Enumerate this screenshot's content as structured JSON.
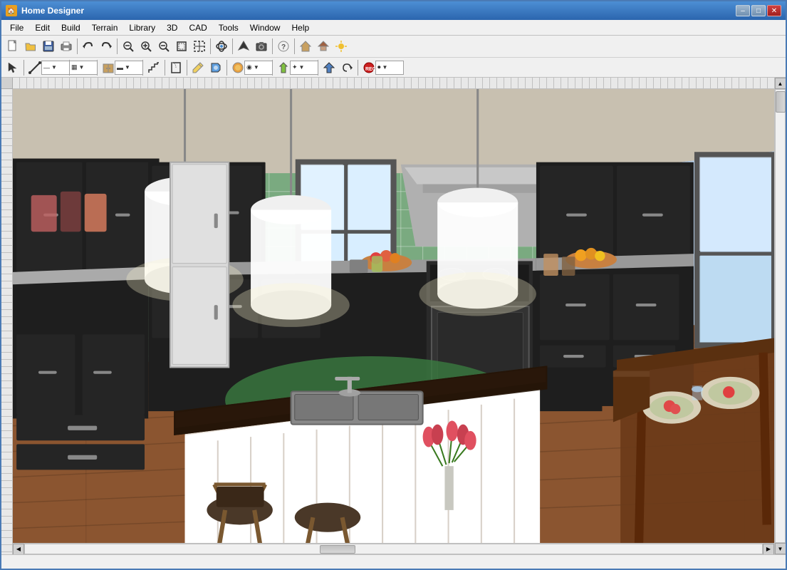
{
  "window": {
    "title": "Home Designer",
    "icon": "🏠"
  },
  "title_buttons": {
    "minimize": "–",
    "maximize": "□",
    "close": "✕"
  },
  "menu": {
    "items": [
      "File",
      "Edit",
      "Build",
      "Terrain",
      "Library",
      "3D",
      "CAD",
      "Tools",
      "Window",
      "Help"
    ]
  },
  "toolbar1": {
    "buttons": [
      {
        "name": "new",
        "icon": "📄"
      },
      {
        "name": "open",
        "icon": "📂"
      },
      {
        "name": "save",
        "icon": "💾"
      },
      {
        "name": "print",
        "icon": "🖨"
      },
      {
        "name": "undo",
        "icon": "↩"
      },
      {
        "name": "redo",
        "icon": "↪"
      },
      {
        "name": "zoom-in-prev",
        "icon": "🔍"
      },
      {
        "name": "zoom-in",
        "icon": "⊕"
      },
      {
        "name": "zoom-out",
        "icon": "⊖"
      },
      {
        "name": "fit-window",
        "icon": "⊞"
      },
      {
        "name": "zoom-box",
        "icon": "▣"
      },
      {
        "name": "refresh",
        "icon": "↺"
      },
      {
        "name": "orbit",
        "icon": "⟳"
      },
      {
        "name": "pan",
        "icon": "✋"
      },
      {
        "name": "mark1",
        "icon": "⟢"
      },
      {
        "name": "arrow-up",
        "icon": "↑"
      },
      {
        "name": "camera",
        "icon": "📷"
      },
      {
        "name": "question",
        "icon": "?"
      },
      {
        "name": "house",
        "icon": "🏠"
      },
      {
        "name": "roof",
        "icon": "⌂"
      },
      {
        "name": "tree",
        "icon": "🌲"
      }
    ]
  },
  "toolbar2": {
    "buttons": [
      {
        "name": "select",
        "icon": "↖"
      },
      {
        "name": "line-draw",
        "icon": "╱"
      },
      {
        "name": "line-type",
        "icon": "—"
      },
      {
        "name": "wall-type",
        "icon": "▦"
      },
      {
        "name": "cabinet",
        "icon": "▬"
      },
      {
        "name": "stairs",
        "icon": "≡"
      },
      {
        "name": "door",
        "icon": "⬚"
      },
      {
        "name": "pencil",
        "icon": "✏"
      },
      {
        "name": "paint",
        "icon": "🖌"
      },
      {
        "name": "material",
        "icon": "◉"
      },
      {
        "name": "object-place",
        "icon": "✦"
      },
      {
        "name": "arrow-up2",
        "icon": "↑"
      },
      {
        "name": "rotate",
        "icon": "↻"
      },
      {
        "name": "record",
        "icon": "⏺"
      }
    ]
  },
  "canvas": {
    "alt_text": "3D Kitchen Design View"
  },
  "status": {
    "text": ""
  }
}
